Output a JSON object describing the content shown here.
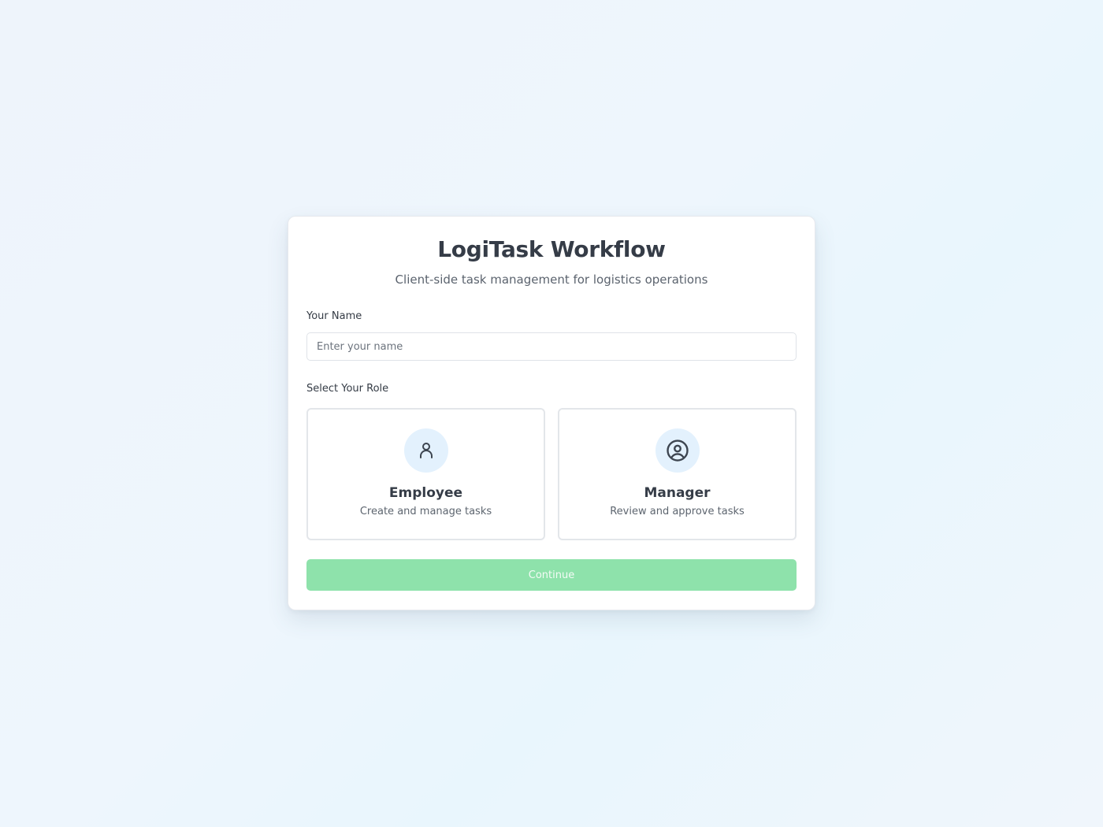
{
  "app": {
    "title": "LogiTask Workflow",
    "subtitle": "Client-side task management for logistics operations"
  },
  "name_field": {
    "label": "Your Name",
    "placeholder": "Enter your name",
    "value": ""
  },
  "role_section": {
    "label": "Select Your Role",
    "roles": [
      {
        "title": "Employee",
        "description": "Create and manage tasks",
        "icon": "user-icon"
      },
      {
        "title": "Manager",
        "description": "Review and approve tasks",
        "icon": "user-circle-icon"
      }
    ]
  },
  "continue_button": {
    "label": "Continue",
    "disabled": true
  },
  "colors": {
    "accent_disabled": "#8ee2ab",
    "icon_bg": "#e3f1fd",
    "text_primary": "#353c47"
  }
}
